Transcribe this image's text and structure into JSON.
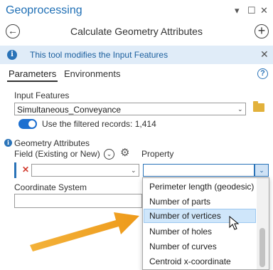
{
  "pane": {
    "title": "Geoprocessing",
    "controls": {
      "pin": "▾",
      "restore": "☐",
      "close": "✕"
    }
  },
  "tool": {
    "title": "Calculate Geometry Attributes",
    "back_symbol": "←",
    "add_symbol": "+"
  },
  "banner": {
    "info_symbol": "i",
    "text": "This tool modifies the Input Features",
    "close_symbol": "✕"
  },
  "tabs": [
    {
      "label": "Parameters",
      "active": true
    },
    {
      "label": "Environments",
      "active": false
    }
  ],
  "help_symbol": "?",
  "input_features": {
    "label": "Input Features",
    "value": "Simultaneous_Conveyance",
    "filter_toggle_label": "Use the filtered records: 1,414",
    "filter_toggle_on": true
  },
  "geometry_attributes": {
    "label": "Geometry Attributes",
    "field_column_label": "Field (Existing or New)",
    "property_column_label": "Property",
    "field_value": "",
    "property_value": ""
  },
  "coordinate_system": {
    "label": "Coordinate System",
    "value": ""
  },
  "property_dropdown": {
    "items": [
      "Perimeter length (geodesic)",
      "Number of parts",
      "Number of vertices",
      "Number of holes",
      "Number of curves",
      "Centroid x-coordinate"
    ],
    "highlighted_index": 2
  },
  "colors": {
    "accent": "#1f6fb5",
    "banner_bg": "#e0ecf8",
    "highlight": "#cfe6fa",
    "annotation_arrow": "#f0a020",
    "remove_red": "#d23b2e"
  }
}
